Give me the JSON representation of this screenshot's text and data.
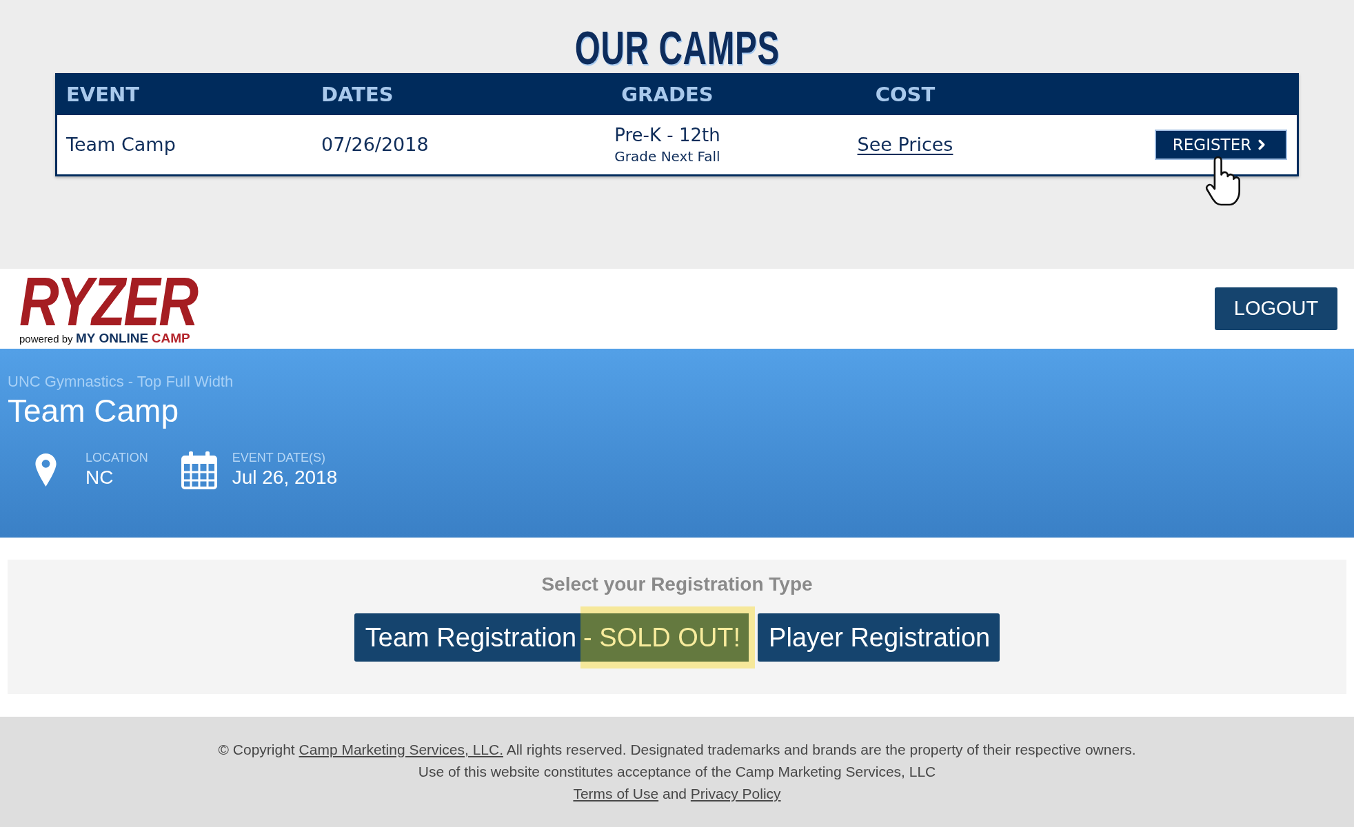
{
  "camps": {
    "title": "OUR CAMPS",
    "table": {
      "columns": [
        "EVENT",
        "DATES",
        "GRADES",
        "COST"
      ],
      "rows": [
        {
          "event": "Team Camp",
          "dates": "07/26/2018",
          "grades": "Pre-K - 12th",
          "grades_note": "Grade Next Fall",
          "cost_link": "See Prices",
          "action": "REGISTER"
        }
      ]
    }
  },
  "header": {
    "logo": {
      "wordmark": "RYZER",
      "tagline_prefix": "powered by",
      "tagline_brand": "MY ONLINE",
      "tagline_accent": "CAMP"
    },
    "logout_button": "LOGOUT"
  },
  "event_banner": {
    "breadcrumb": "UNC Gymnastics - Top Full Width",
    "title": "Team Camp",
    "details": [
      {
        "kind": "location",
        "label": "LOCATION",
        "value": "NC"
      },
      {
        "kind": "dates",
        "label": "EVENT DATE(S)",
        "value": "Jul 26, 2018"
      }
    ]
  },
  "registration": {
    "heading": "Select your Registration Type",
    "options": [
      {
        "label": "Team Registration",
        "note": "- SOLD OUT!"
      },
      {
        "label": "Player Registration"
      }
    ]
  },
  "footer": {
    "copyright": {
      "prefix": "© Copyright",
      "link": "Camp Marketing Services, LLC.",
      "suffix": "All rights reserved. Designated trademarks and brands are the property of their respective owners."
    },
    "notice": "Use of this website constitutes acceptance of the Camp Marketing Services, LLC",
    "legal_links": [
      "Terms of Use",
      "Privacy Policy"
    ],
    "legal_joiner": "and"
  }
}
